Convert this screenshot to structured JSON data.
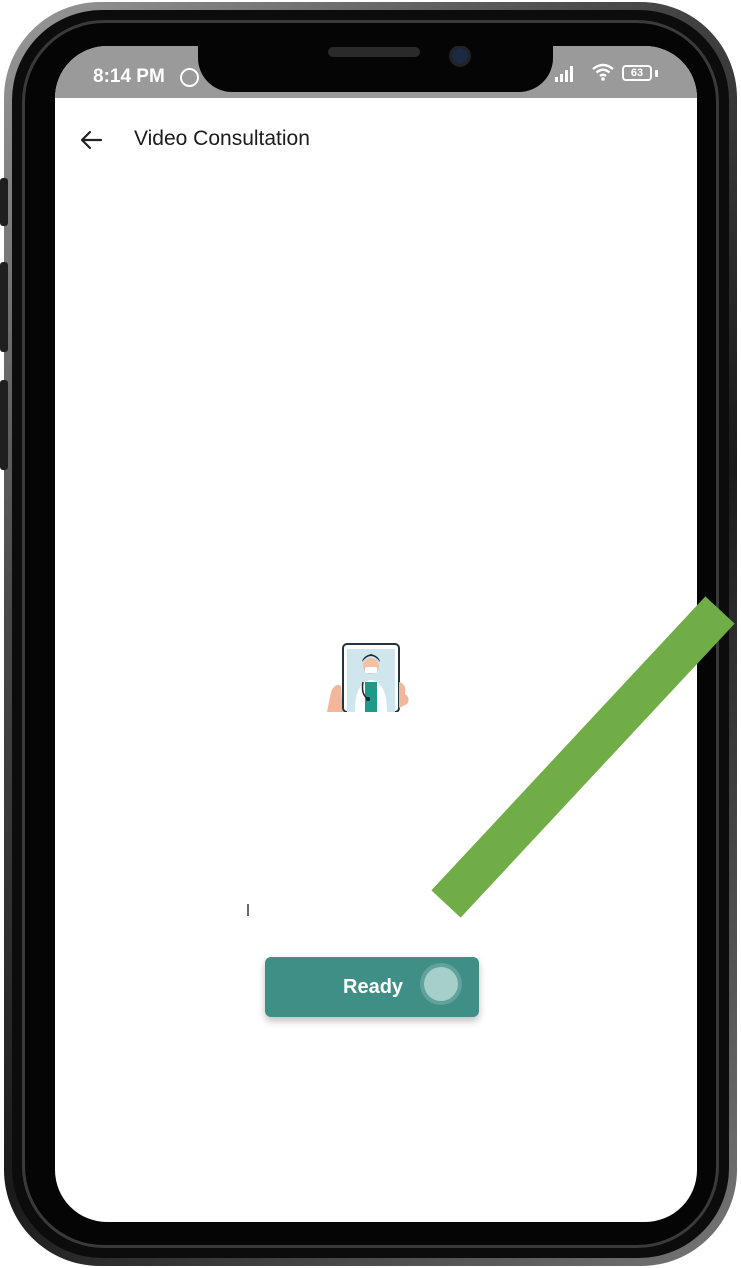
{
  "status_bar": {
    "time": "8:14 PM",
    "battery": "63",
    "icons": [
      "alarm-icon",
      "signal-icon",
      "wifi-icon",
      "battery-icon"
    ]
  },
  "header": {
    "back_icon": "back-arrow-icon",
    "title": "Video Consultation"
  },
  "illustration": {
    "name": "doctor-video-call-illustration"
  },
  "ready_button": {
    "label": "Ready",
    "color": "#3f8f86"
  },
  "annotation": {
    "arrow_color": "#70ad47"
  }
}
